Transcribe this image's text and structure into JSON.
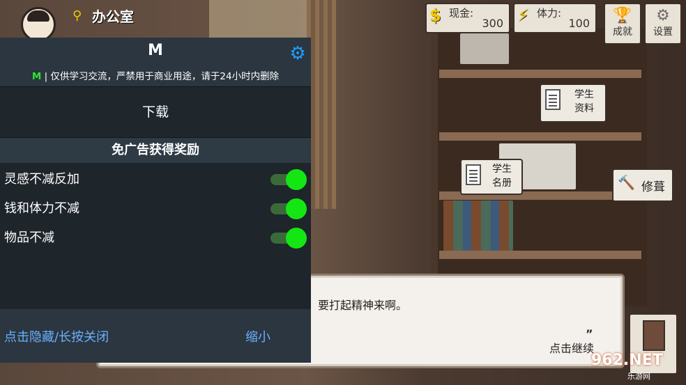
{
  "game": {
    "location": "办公室",
    "hud": {
      "cash_label": "现金:",
      "cash_value": "300",
      "stamina_label": "体力:",
      "stamina_value": "100",
      "achievements_label": "成就",
      "settings_label": "设置"
    },
    "bubbles": {
      "student_profile": "学生\n资料",
      "student_roster": "学生\n名册",
      "repair": "修葺"
    },
    "dialog": {
      "text": "，要打起精神来啊。",
      "continue_label": "点击继续"
    },
    "watermark": "962.NET",
    "watermark_sub": "乐游网"
  },
  "menu": {
    "title": "M",
    "notice_prefix": "M",
    "notice_text": "| 仅供学习交流，严禁用于商业用途，请于24小时内删除",
    "download_label": "下载",
    "section_title": "免广告获得奖励",
    "options": [
      {
        "label": "灵感不减反加",
        "enabled": true
      },
      {
        "label": "钱和体力不减",
        "enabled": true
      },
      {
        "label": "物品不减",
        "enabled": true
      }
    ],
    "footer": {
      "hide_label": "点击隐藏/长按关闭",
      "minimize_label": "缩小"
    }
  },
  "colors": {
    "menu_bg": "#1e252b",
    "menu_header": "#2b3640",
    "accent_green": "#14e614",
    "link_blue": "#6ab0ff",
    "gear_blue": "#1ea0ff"
  }
}
